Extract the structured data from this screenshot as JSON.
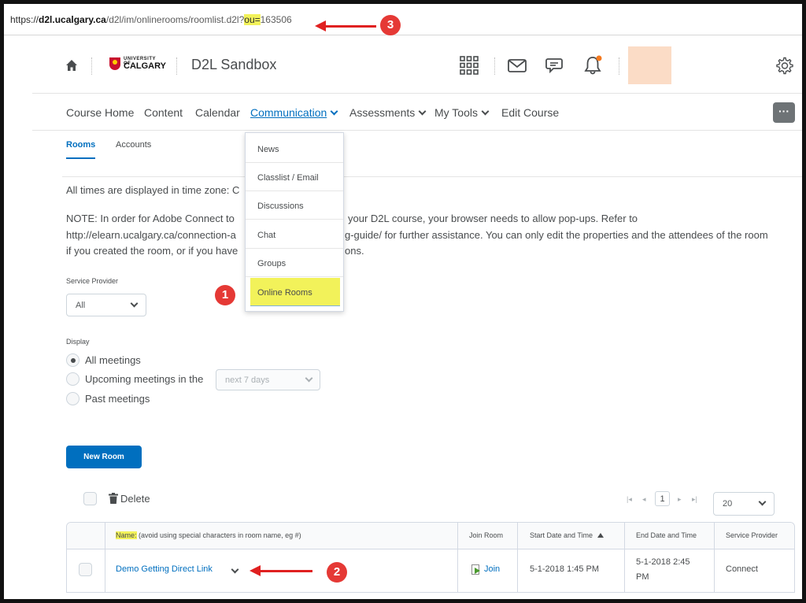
{
  "browser": {
    "url_scheme": "https://",
    "url_host": "d2l.ucalgary.ca",
    "url_path": "/d2l/im/onlinerooms/roomlist.d2l?",
    "url_param": "ou=",
    "url_value": "163506"
  },
  "annotations": {
    "badge_1": "1",
    "badge_2": "2",
    "badge_3": "3",
    "highlight_color": "#f2f25a",
    "arrow_color": "#e02020"
  },
  "header": {
    "logo_small": "UNIVERSITY OF",
    "logo_big": "CALGARY",
    "site_title": "D2L Sandbox",
    "icons": [
      "home-icon",
      "waffle-icon",
      "mail-icon",
      "chat-icon",
      "bell-icon",
      "gear-icon"
    ]
  },
  "nav": {
    "items": [
      {
        "label": "Course Home"
      },
      {
        "label": "Content"
      },
      {
        "label": "Calendar"
      },
      {
        "label": "Communication"
      },
      {
        "label": "Assessments"
      },
      {
        "label": "My Tools"
      },
      {
        "label": "Edit Course"
      }
    ],
    "more": "···"
  },
  "subtabs": {
    "rooms": "Rooms",
    "accounts": "Accounts"
  },
  "communication_menu": {
    "items": [
      {
        "label": "News"
      },
      {
        "label": "Classlist / Email"
      },
      {
        "label": "Discussions"
      },
      {
        "label": "Chat"
      },
      {
        "label": "Groups"
      },
      {
        "label": "Online Rooms"
      }
    ]
  },
  "content": {
    "timezone": "All times are displayed in time zone: C",
    "note_line1_a": "NOTE: In order for Adobe Connect to",
    "note_line1_b": "your D2L course, your browser needs to allow pop-ups. Refer to",
    "note_line2_a": "http://elearn.ucalgary.ca/connection-a",
    "note_line2_b": "g-guide/ for further assistance. You can only edit the properties and the attendees of the room",
    "note_line3_a": "if you created the room, or if you have",
    "note_line3_b": "ons."
  },
  "filters": {
    "service_provider_label": "Service Provider",
    "service_provider_value": "All",
    "display_label": "Display",
    "options": [
      {
        "label": "All meetings",
        "selected": true
      },
      {
        "label": "Upcoming meetings in the",
        "selected": false
      },
      {
        "label": "Past meetings",
        "selected": false
      }
    ],
    "upcoming_range": "next 7 days"
  },
  "actions": {
    "new_room": "New Room",
    "delete": "Delete"
  },
  "pagination": {
    "first": "|◂",
    "prev": "◂",
    "page": "1",
    "next": "▸",
    "last": "▸|",
    "per_page": "20"
  },
  "table": {
    "columns": {
      "name_highlight": "Name:",
      "name_hint": " (avoid using special characters in room name, eg #)",
      "join_room": "Join Room",
      "start": "Start Date and Time",
      "end": "End Date and Time",
      "provider": "Service Provider"
    },
    "rows": [
      {
        "name": "Demo Getting Direct Link",
        "join": "Join",
        "start": "5-1-2018 1:45 PM",
        "end_line1": "5-1-2018 2:45",
        "end_line2": "PM",
        "provider": "Connect"
      }
    ]
  }
}
